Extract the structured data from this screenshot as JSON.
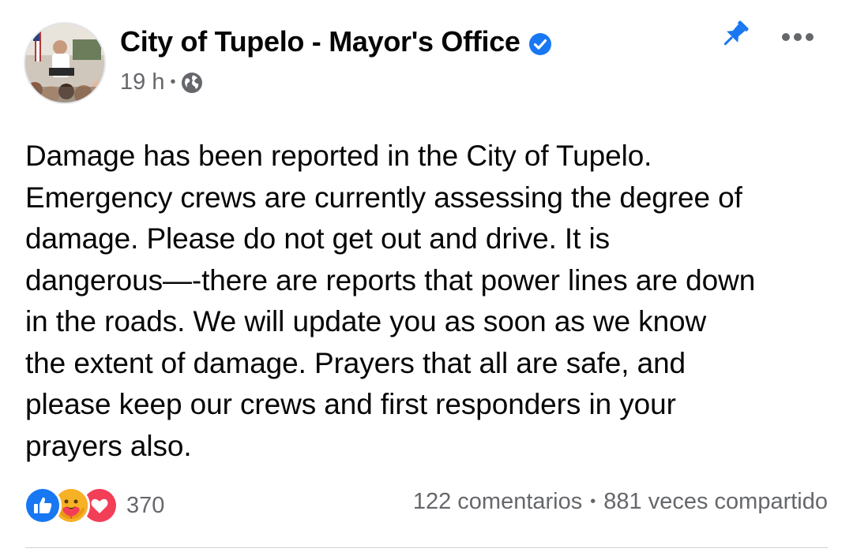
{
  "post": {
    "author": "City of Tupelo - Mayor's Office",
    "time": "19 h",
    "separator": "•",
    "body": "Damage has been reported in the City of Tupelo.\nEmergency crews are currently assessing the degree of\ndamage. Please do not get out and drive. It is\ndangerous—-there are reports that power lines are down\nin the roads. We will update you as soon as we know\nthe extent of damage. Prayers that all are safe, and\nplease keep our crews and first responders in your\nprayers also."
  },
  "icons": {
    "verified": "verified-badge-icon",
    "privacy": "globe-icon",
    "pin": "pin-icon",
    "more": "more-icon",
    "reactions": [
      "like-icon",
      "care-icon",
      "love-icon"
    ]
  },
  "engagement": {
    "reactions_count": "370",
    "comments": "122 comentarios",
    "separator": "•",
    "shares": "881 veces compartido"
  },
  "colors": {
    "accent": "#1877f2",
    "like": "#1877f2",
    "love": "#f33e58",
    "care": "#f7b125",
    "secondary_text": "#65676b"
  }
}
